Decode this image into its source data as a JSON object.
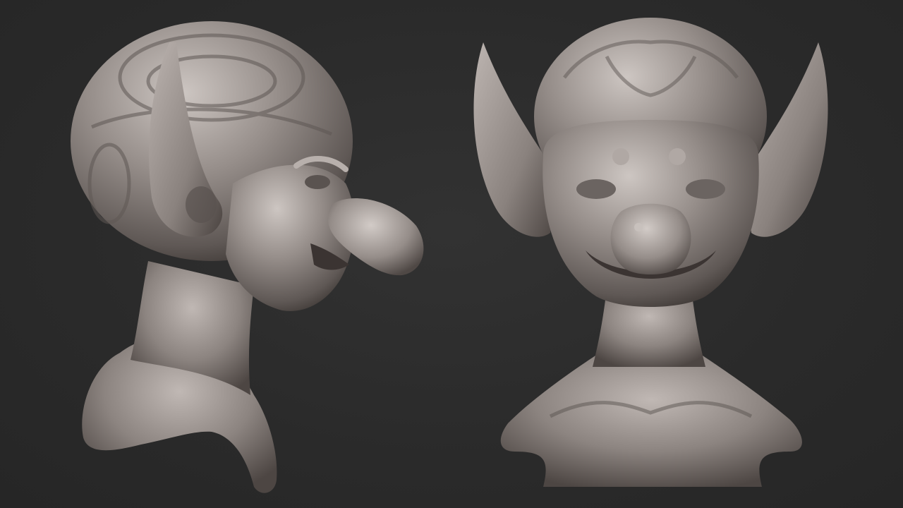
{
  "scene": {
    "background_color": "#2b2b2b",
    "clay_color": "#8e8682",
    "clay_highlight": "#c9c2be",
    "clay_shadow": "#4e4744",
    "subjects": [
      {
        "view": "side-profile",
        "subject": "goblin-bust-sculpt"
      },
      {
        "view": "front",
        "subject": "goblin-bust-sculpt"
      }
    ]
  }
}
